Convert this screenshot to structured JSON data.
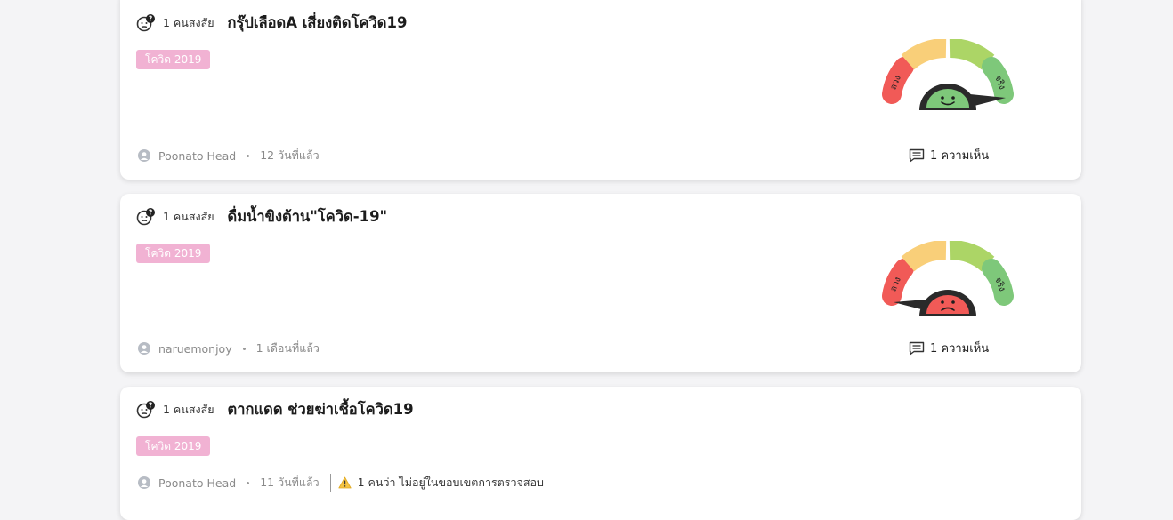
{
  "feed": {
    "cards": [
      {
        "doubt_count": "1 คนสงสัย",
        "title": "กรุ๊ปเลือดA เสี่ยงติดโควิด19",
        "tag": "โควิด 2019",
        "author": "Poonato Head",
        "time": "12 วันที่แล้ว",
        "gauge": {
          "left_label": "ลวง",
          "right_label": "จริง",
          "verdict": "true",
          "face_color": "#7ec87a"
        },
        "comments": "1 ความเห็น"
      },
      {
        "doubt_count": "1 คนสงสัย",
        "title": "ดื่มน้ำขิงต้าน\"โควิด-19\"",
        "tag": "โควิด 2019",
        "author": "naruemonjoy",
        "time": "1 เดือนที่แล้ว",
        "gauge": {
          "left_label": "ลวง",
          "right_label": "จริง",
          "verdict": "false",
          "face_color": "#f15a57"
        },
        "comments": "1 ความเห็น"
      },
      {
        "doubt_count": "1 คนสงสัย",
        "title": "ตากแดด ช่วยฆ่าเชื้อโควิด19",
        "tag": "โควิด 2019",
        "author": "Poonato Head",
        "time": "11 วันที่แล้ว",
        "notice": "1 คนว่า ไม่อยู่ในขอบเขตการตรวจสอบ"
      }
    ]
  },
  "colors": {
    "tag_bg": "#f1b2d3",
    "gauge_red": "#f15a57",
    "gauge_orange": "#f9cf79",
    "gauge_lime": "#acd566",
    "gauge_green": "#7ec87a",
    "gauge_dark": "#2a2a2a"
  },
  "icons": {
    "doubt": "doubt-face-icon",
    "user": "user-icon",
    "comment": "comment-icon",
    "warning": "warning-icon"
  }
}
